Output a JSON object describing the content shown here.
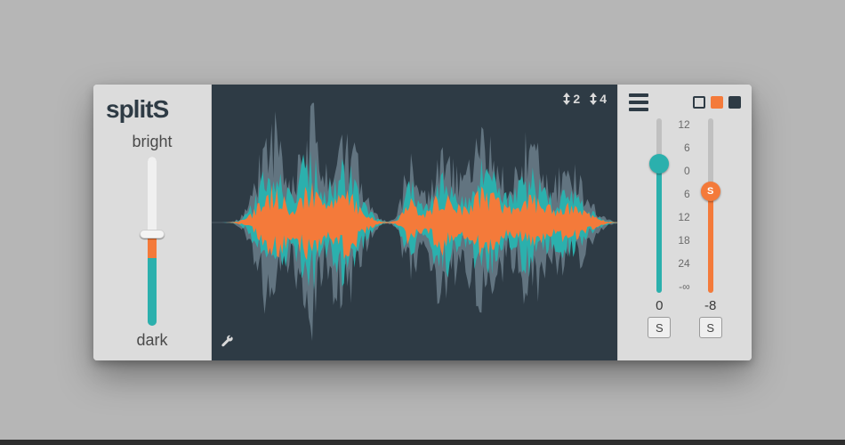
{
  "plugin": {
    "name_a": "split",
    "name_b": "S"
  },
  "tone": {
    "label_top": "bright",
    "label_bottom": "dark",
    "upper_pct": 46,
    "mid_pct": 14,
    "lower_pct": 40,
    "thumb_pct": 46,
    "mid_color": "#f47a3a",
    "lower_color": "#2bb0ad"
  },
  "header_icons": {
    "zoom_a": "2",
    "zoom_b": "4"
  },
  "swatches": {
    "a": "#f47a3a",
    "b": "#2e3b45"
  },
  "scale": [
    "12",
    "6",
    "0",
    "6",
    "12",
    "18",
    "24",
    "-∞"
  ],
  "fader_a": {
    "color": "#2bb0ad",
    "knob_pct": 26,
    "knob_label": "",
    "value": "0",
    "solo": "S"
  },
  "fader_b": {
    "color": "#f47a3a",
    "knob_pct": 42,
    "knob_label": "S",
    "value": "-8",
    "solo": "S"
  },
  "waveform": {
    "bg_color": "#627480",
    "fg_a": "#2bb0ad",
    "fg_b": "#f47a3a"
  }
}
